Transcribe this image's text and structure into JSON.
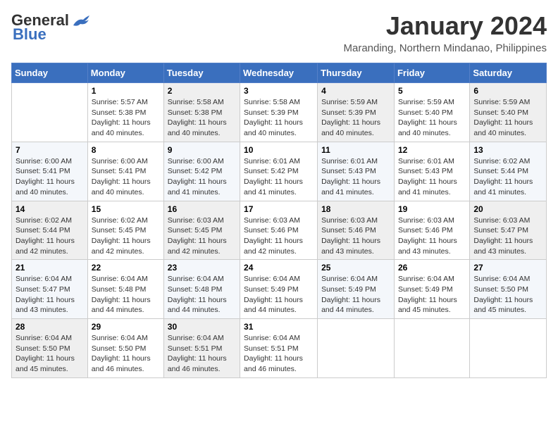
{
  "header": {
    "logo_general": "General",
    "logo_blue": "Blue",
    "month": "January 2024",
    "location": "Maranding, Northern Mindanao, Philippines"
  },
  "columns": [
    "Sunday",
    "Monday",
    "Tuesday",
    "Wednesday",
    "Thursday",
    "Friday",
    "Saturday"
  ],
  "weeks": [
    [
      {
        "num": "",
        "info": ""
      },
      {
        "num": "1",
        "info": "Sunrise: 5:57 AM\nSunset: 5:38 PM\nDaylight: 11 hours\nand 40 minutes."
      },
      {
        "num": "2",
        "info": "Sunrise: 5:58 AM\nSunset: 5:38 PM\nDaylight: 11 hours\nand 40 minutes."
      },
      {
        "num": "3",
        "info": "Sunrise: 5:58 AM\nSunset: 5:39 PM\nDaylight: 11 hours\nand 40 minutes."
      },
      {
        "num": "4",
        "info": "Sunrise: 5:59 AM\nSunset: 5:39 PM\nDaylight: 11 hours\nand 40 minutes."
      },
      {
        "num": "5",
        "info": "Sunrise: 5:59 AM\nSunset: 5:40 PM\nDaylight: 11 hours\nand 40 minutes."
      },
      {
        "num": "6",
        "info": "Sunrise: 5:59 AM\nSunset: 5:40 PM\nDaylight: 11 hours\nand 40 minutes."
      }
    ],
    [
      {
        "num": "7",
        "info": "Sunrise: 6:00 AM\nSunset: 5:41 PM\nDaylight: 11 hours\nand 40 minutes."
      },
      {
        "num": "8",
        "info": "Sunrise: 6:00 AM\nSunset: 5:41 PM\nDaylight: 11 hours\nand 40 minutes."
      },
      {
        "num": "9",
        "info": "Sunrise: 6:00 AM\nSunset: 5:42 PM\nDaylight: 11 hours\nand 41 minutes."
      },
      {
        "num": "10",
        "info": "Sunrise: 6:01 AM\nSunset: 5:42 PM\nDaylight: 11 hours\nand 41 minutes."
      },
      {
        "num": "11",
        "info": "Sunrise: 6:01 AM\nSunset: 5:43 PM\nDaylight: 11 hours\nand 41 minutes."
      },
      {
        "num": "12",
        "info": "Sunrise: 6:01 AM\nSunset: 5:43 PM\nDaylight: 11 hours\nand 41 minutes."
      },
      {
        "num": "13",
        "info": "Sunrise: 6:02 AM\nSunset: 5:44 PM\nDaylight: 11 hours\nand 41 minutes."
      }
    ],
    [
      {
        "num": "14",
        "info": "Sunrise: 6:02 AM\nSunset: 5:44 PM\nDaylight: 11 hours\nand 42 minutes."
      },
      {
        "num": "15",
        "info": "Sunrise: 6:02 AM\nSunset: 5:45 PM\nDaylight: 11 hours\nand 42 minutes."
      },
      {
        "num": "16",
        "info": "Sunrise: 6:03 AM\nSunset: 5:45 PM\nDaylight: 11 hours\nand 42 minutes."
      },
      {
        "num": "17",
        "info": "Sunrise: 6:03 AM\nSunset: 5:46 PM\nDaylight: 11 hours\nand 42 minutes."
      },
      {
        "num": "18",
        "info": "Sunrise: 6:03 AM\nSunset: 5:46 PM\nDaylight: 11 hours\nand 43 minutes."
      },
      {
        "num": "19",
        "info": "Sunrise: 6:03 AM\nSunset: 5:46 PM\nDaylight: 11 hours\nand 43 minutes."
      },
      {
        "num": "20",
        "info": "Sunrise: 6:03 AM\nSunset: 5:47 PM\nDaylight: 11 hours\nand 43 minutes."
      }
    ],
    [
      {
        "num": "21",
        "info": "Sunrise: 6:04 AM\nSunset: 5:47 PM\nDaylight: 11 hours\nand 43 minutes."
      },
      {
        "num": "22",
        "info": "Sunrise: 6:04 AM\nSunset: 5:48 PM\nDaylight: 11 hours\nand 44 minutes."
      },
      {
        "num": "23",
        "info": "Sunrise: 6:04 AM\nSunset: 5:48 PM\nDaylight: 11 hours\nand 44 minutes."
      },
      {
        "num": "24",
        "info": "Sunrise: 6:04 AM\nSunset: 5:49 PM\nDaylight: 11 hours\nand 44 minutes."
      },
      {
        "num": "25",
        "info": "Sunrise: 6:04 AM\nSunset: 5:49 PM\nDaylight: 11 hours\nand 44 minutes."
      },
      {
        "num": "26",
        "info": "Sunrise: 6:04 AM\nSunset: 5:49 PM\nDaylight: 11 hours\nand 45 minutes."
      },
      {
        "num": "27",
        "info": "Sunrise: 6:04 AM\nSunset: 5:50 PM\nDaylight: 11 hours\nand 45 minutes."
      }
    ],
    [
      {
        "num": "28",
        "info": "Sunrise: 6:04 AM\nSunset: 5:50 PM\nDaylight: 11 hours\nand 45 minutes."
      },
      {
        "num": "29",
        "info": "Sunrise: 6:04 AM\nSunset: 5:50 PM\nDaylight: 11 hours\nand 46 minutes."
      },
      {
        "num": "30",
        "info": "Sunrise: 6:04 AM\nSunset: 5:51 PM\nDaylight: 11 hours\nand 46 minutes."
      },
      {
        "num": "31",
        "info": "Sunrise: 6:04 AM\nSunset: 5:51 PM\nDaylight: 11 hours\nand 46 minutes."
      },
      {
        "num": "",
        "info": ""
      },
      {
        "num": "",
        "info": ""
      },
      {
        "num": "",
        "info": ""
      }
    ]
  ]
}
